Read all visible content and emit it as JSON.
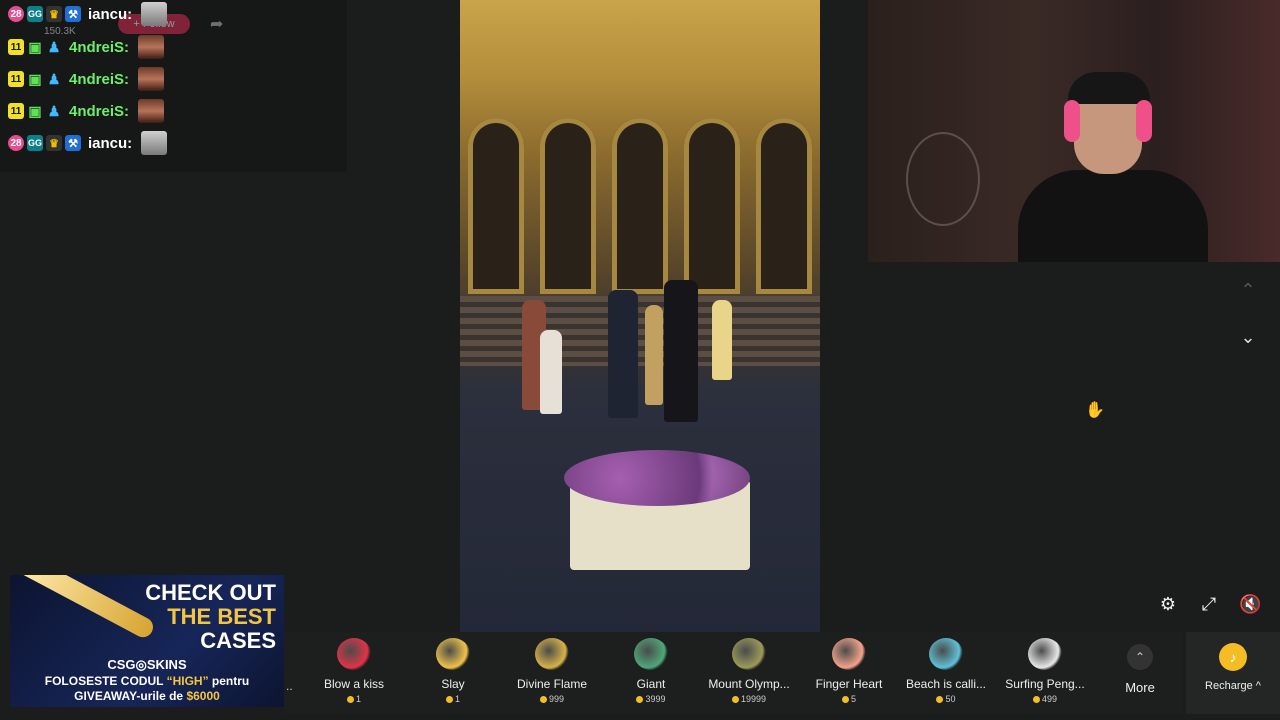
{
  "chat": {
    "ghost_follow": "+ Follow",
    "ghost_viewers": "150.3K",
    "messages": [
      {
        "level": "28",
        "user": "iancu:",
        "user_color": "#ffffff",
        "type": "mod"
      },
      {
        "level": "11",
        "user": "4ndreiS:",
        "user_color": "#6cf06a",
        "type": "sub"
      },
      {
        "level": "11",
        "user": "4ndreiS:",
        "user_color": "#6cf06a",
        "type": "sub"
      },
      {
        "level": "11",
        "user": "4ndreiS:",
        "user_color": "#6cf06a",
        "type": "sub"
      },
      {
        "level": "28",
        "user": "iancu:",
        "user_color": "#ffffff",
        "type": "mod"
      }
    ]
  },
  "ad": {
    "headline_1": "CHECK OUT",
    "headline_2": "THE BEST",
    "headline_3": "CASES",
    "brand": "CSG◎SKINS",
    "line2_a": "FOLOSESTE CODUL ",
    "line2_code": "“HIGH”",
    "line2_b": " pentru",
    "line3_a": "GIVEAWAY-urile de ",
    "line3_amount": "$6000"
  },
  "gifts": [
    {
      "name": "Blow a kiss",
      "price": "1",
      "color": "#e23347"
    },
    {
      "name": "Slay",
      "price": "1",
      "color": "#f0c24a"
    },
    {
      "name": "Divine Flame",
      "price": "999",
      "color": "#d8b24a"
    },
    {
      "name": "Giant",
      "price": "3999",
      "color": "#4fa77a"
    },
    {
      "name": "Mount Olymp...",
      "price": "19999",
      "color": "#9c9a5a"
    },
    {
      "name": "Finger Heart",
      "price": "5",
      "color": "#f2a38a"
    },
    {
      "name": "Beach is calli...",
      "price": "50",
      "color": "#5fc1d6"
    },
    {
      "name": "Surfing Peng...",
      "price": "499",
      "color": "#e8e8e8"
    }
  ],
  "gift_edge": "..",
  "more_label": "More",
  "recharge_label": "Recharge ^",
  "icons": {
    "nav_up": "chevron-up-icon",
    "nav_down": "chevron-down-icon",
    "settings": "settings-icon",
    "exit_fullscreen": "exit-fullscreen-icon",
    "mute": "mute-icon"
  }
}
